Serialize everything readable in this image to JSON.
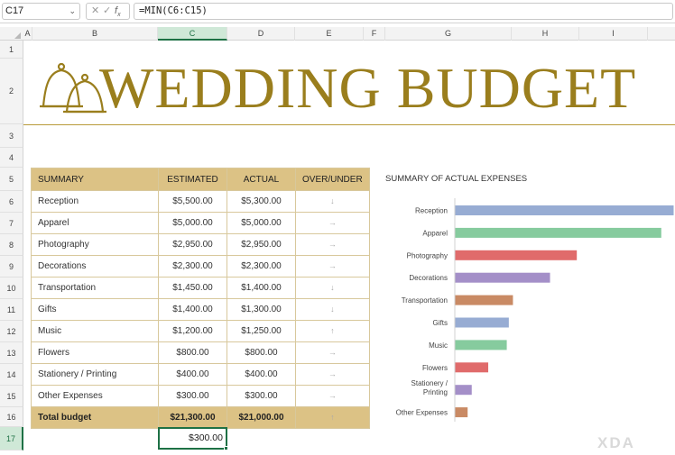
{
  "formula_bar": {
    "name_box": "C17",
    "formula": "=MIN(C6:C15)"
  },
  "columns": [
    "A",
    "B",
    "C",
    "D",
    "E",
    "F",
    "G",
    "H",
    "I"
  ],
  "rows": [
    "1",
    "2",
    "3",
    "4",
    "5",
    "6",
    "7",
    "8",
    "9",
    "10",
    "11",
    "12",
    "13",
    "14",
    "15",
    "16",
    "17"
  ],
  "title": "WEDDING BUDGET",
  "table": {
    "headers": [
      "SUMMARY",
      "ESTIMATED",
      "ACTUAL",
      "OVER/UNDER"
    ],
    "rows": [
      {
        "name": "Reception",
        "estimated": "$5,500.00",
        "actual": "$5,300.00",
        "arrow": "down"
      },
      {
        "name": "Apparel",
        "estimated": "$5,000.00",
        "actual": "$5,000.00",
        "arrow": "right"
      },
      {
        "name": "Photography",
        "estimated": "$2,950.00",
        "actual": "$2,950.00",
        "arrow": "right"
      },
      {
        "name": "Decorations",
        "estimated": "$2,300.00",
        "actual": "$2,300.00",
        "arrow": "right"
      },
      {
        "name": "Transportation",
        "estimated": "$1,450.00",
        "actual": "$1,400.00",
        "arrow": "down"
      },
      {
        "name": "Gifts",
        "estimated": "$1,400.00",
        "actual": "$1,300.00",
        "arrow": "down"
      },
      {
        "name": "Music",
        "estimated": "$1,200.00",
        "actual": "$1,250.00",
        "arrow": "up"
      },
      {
        "name": "Flowers",
        "estimated": "$800.00",
        "actual": "$800.00",
        "arrow": "right"
      },
      {
        "name": "Stationery / Printing",
        "estimated": "$400.00",
        "actual": "$400.00",
        "arrow": "right"
      },
      {
        "name": "Other Expenses",
        "estimated": "$300.00",
        "actual": "$300.00",
        "arrow": "right"
      }
    ],
    "total": {
      "name": "Total budget",
      "estimated": "$21,300.00",
      "actual": "$21,000.00",
      "arrow": "up"
    }
  },
  "selected_cell_value": "$300.00",
  "chart_data": {
    "type": "bar",
    "title": "SUMMARY OF ACTUAL EXPENSES",
    "orientation": "horizontal",
    "categories": [
      "Reception",
      "Apparel",
      "Photography",
      "Decorations",
      "Transportation",
      "Gifts",
      "Music",
      "Flowers",
      "Stationery / Printing",
      "Other Expenses"
    ],
    "values": [
      5300,
      5000,
      2950,
      2300,
      1400,
      1300,
      1250,
      800,
      400,
      300
    ],
    "colors": [
      "#97acd3",
      "#86cb9e",
      "#e06b6b",
      "#a48fc8",
      "#c98a64",
      "#97acd3",
      "#86cb9e",
      "#e06b6b",
      "#a48fc8",
      "#c98a64"
    ],
    "xlim": [
      0,
      5300
    ]
  },
  "watermark": "XDA",
  "colors": {
    "gold": "#9a7e1d",
    "header_fill": "#dcc285",
    "selection": "#1e7145"
  }
}
